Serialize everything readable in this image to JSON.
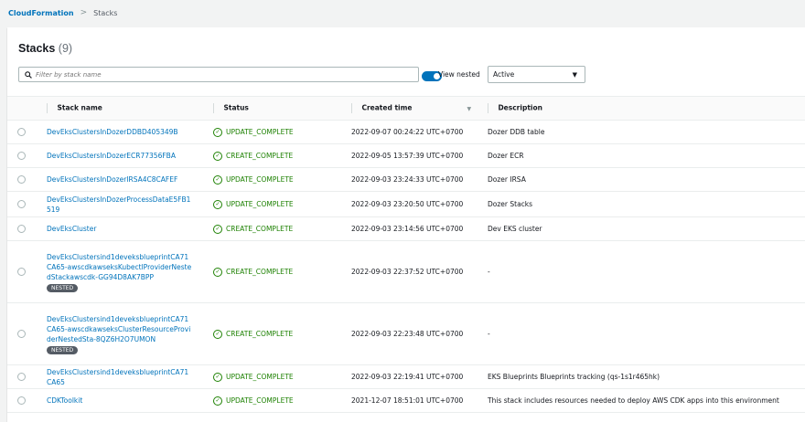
{
  "breadcrumb": {
    "root": "CloudFormation",
    "current": "Stacks"
  },
  "panel": {
    "title": "Stacks",
    "count": "(9)"
  },
  "filter": {
    "placeholder": "Filter by stack name"
  },
  "view_nested": {
    "label": "View nested",
    "enabled": true
  },
  "status_select": {
    "value": "Active"
  },
  "columns": [
    "Stack name",
    "Status",
    "Created time",
    "Description"
  ],
  "nested_badge": "NESTED",
  "rows": [
    {
      "name": "DevEksClustersInDozerDDBD405349B",
      "status": "UPDATE_COMPLETE",
      "created": "2022-09-07 00:24:22 UTC+0700",
      "description": "Dozer DDB table"
    },
    {
      "name": "DevEksClustersInDozerECR77356FBA",
      "status": "CREATE_COMPLETE",
      "created": "2022-09-05 13:57:39 UTC+0700",
      "description": "Dozer ECR"
    },
    {
      "name": "DevEksClustersInDozerIRSA4C8CAFEF",
      "status": "UPDATE_COMPLETE",
      "created": "2022-09-03 23:24:33 UTC+0700",
      "description": "Dozer IRSA"
    },
    {
      "name": "DevEksClustersInDozerProcessDataE5FB1519",
      "status": "UPDATE_COMPLETE",
      "created": "2022-09-03 23:20:50 UTC+0700",
      "description": "Dozer Stacks"
    },
    {
      "name": "DevEksCluster",
      "status": "CREATE_COMPLETE",
      "created": "2022-09-03 23:14:56 UTC+0700",
      "description": "Dev EKS cluster"
    },
    {
      "name": "DevEksClustersind1deveksblueprintCA71CA65-awscdkawseksKubectlProviderNestedStackawscdk-GG94D8AK7BPP",
      "status": "CREATE_COMPLETE",
      "created": "2022-09-03 22:37:52 UTC+0700",
      "description": "-"
    },
    {
      "name": "DevEksClustersind1deveksblueprintCA71CA65-awscdkawseksClusterResourceProviderNestedSta-8QZ6H2O7UMON",
      "status": "CREATE_COMPLETE",
      "created": "2022-09-03 22:23:48 UTC+0700",
      "description": "-"
    },
    {
      "name": "DevEksClustersind1deveksblueprintCA71CA65",
      "status": "UPDATE_COMPLETE",
      "created": "2022-09-03 22:19:41 UTC+0700",
      "description": "EKS Blueprints Blueprints tracking (qs-1s1r465hk)"
    },
    {
      "name": "CDKToolkit",
      "status": "UPDATE_COMPLETE",
      "created": "2021-12-07 18:51:01 UTC+0700",
      "description": "This stack includes resources needed to deploy AWS CDK apps into this environment"
    }
  ],
  "colors": {
    "link": "#0073bb",
    "success": "#1d8102",
    "toggle": "#0073bb"
  }
}
